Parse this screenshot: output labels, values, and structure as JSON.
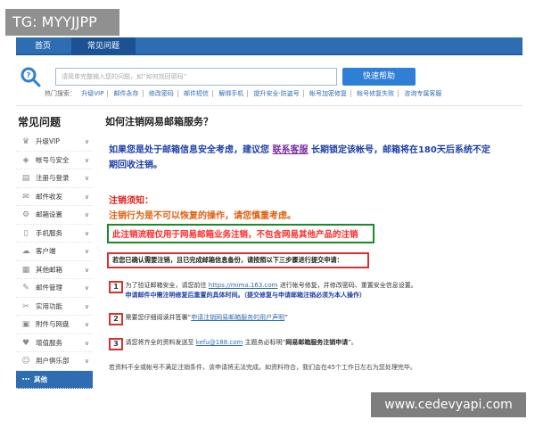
{
  "overlay_tag": "TG: MYYJJPP",
  "nav": {
    "home": "首页",
    "faq": "常见问题"
  },
  "search": {
    "placeholder": "请简单完整输入您的问题，如“如何找回密码”",
    "button": "快速帮助",
    "hot_label": "热门搜索：",
    "hot_links": [
      "升级VIP",
      "邮件永存",
      "修改密码",
      "邮件短信",
      "解绑手机",
      "提升安全·防盗号",
      "帐号加密修复",
      "帐号修复失败",
      "咨询专属客服"
    ]
  },
  "sidebar": {
    "title": "常见问题",
    "items": [
      {
        "label": "升级VIP",
        "icon": "crown-icon"
      },
      {
        "label": "帐号与安全",
        "icon": "shield-icon"
      },
      {
        "label": "注册与登录",
        "icon": "doc-icon"
      },
      {
        "label": "邮件收发",
        "icon": "mail-icon"
      },
      {
        "label": "邮箱设置",
        "icon": "gear-icon"
      },
      {
        "label": "手机服务",
        "icon": "phone-icon"
      },
      {
        "label": "客户端",
        "icon": "cloud-icon"
      },
      {
        "label": "其他邮箱",
        "icon": "mailbox-icon"
      },
      {
        "label": "邮件管理",
        "icon": "pencil-icon"
      },
      {
        "label": "实用功能",
        "icon": "tool-icon"
      },
      {
        "label": "附件与网盘",
        "icon": "clip-icon"
      },
      {
        "label": "增值服务",
        "icon": "heart-icon"
      },
      {
        "label": "用户俱乐部",
        "icon": "user-icon"
      },
      {
        "label": "其他",
        "icon": "dots-icon",
        "active": true
      }
    ]
  },
  "main": {
    "title": "如何注销网易邮箱服务？",
    "intro_a": "如果您是处于邮箱信息安全考虑，建议您",
    "intro_link": "联系客服",
    "intro_b": "长期锁定该帐号，邮箱将在180天后系统不定期回收注销。",
    "notice_title": "注销须知：",
    "notice_line": "注销行为是不可以恢复的操作，请您慎重考虑。",
    "green_notice": "此注销流程仅用于网易邮箱业务注销，不包含网易其他产品的注销",
    "red_notice": "若您已确认需要注销，且已完成邮箱信息备份，请按照以下三步骤进行提交申请：",
    "steps": [
      {
        "num": "1",
        "a": "为了验证邮箱安全，请您前往",
        "link": "https://mima.163.com",
        "b": "进行帐号修复，并修改密码、重置安全信息设置。",
        "c": "申请邮件中需注明修复后重置的具体时间。（提交修复与申请邮箱注销必须为本人操作）"
      },
      {
        "num": "2",
        "a": "需要您仔细阅读并签署“",
        "link": "申请注销网易邮箱服务的用户声明",
        "b": "”"
      },
      {
        "num": "3",
        "a": "请您将齐全的资料发送至",
        "link": "kefu@188.com",
        "b": "主题务必标明“",
        "strong": "网易邮箱服务注销申请",
        "c": "”。"
      }
    ],
    "footnote": "若资料不全或帐号不满足注销条件，该申请将无法完成。如资料符合，我们会在45个工作日左右为您处理完毕。"
  },
  "watermark": "www.cedevyapi.com"
}
